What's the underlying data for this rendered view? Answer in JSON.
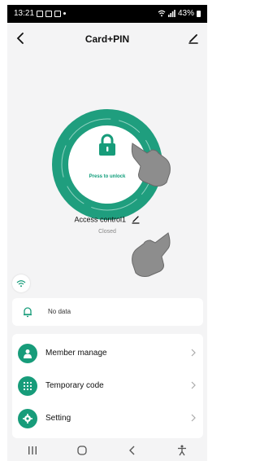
{
  "status_bar": {
    "time": "13:21",
    "battery": "43%"
  },
  "header": {
    "title": "Card+PIN"
  },
  "lock": {
    "prompt": "Press to unlock"
  },
  "device": {
    "name": "Access control1",
    "status": "Closed"
  },
  "notifications": {
    "empty_text": "No data"
  },
  "menu": {
    "items": [
      {
        "label": "Member manage",
        "icon": "person-icon"
      },
      {
        "label": "Temporary code",
        "icon": "keypad-icon"
      },
      {
        "label": "Setting",
        "icon": "gear-icon"
      }
    ]
  },
  "colors": {
    "accent": "#179c7a",
    "ring": "#1f9e7e",
    "background": "#f4f4f5"
  }
}
